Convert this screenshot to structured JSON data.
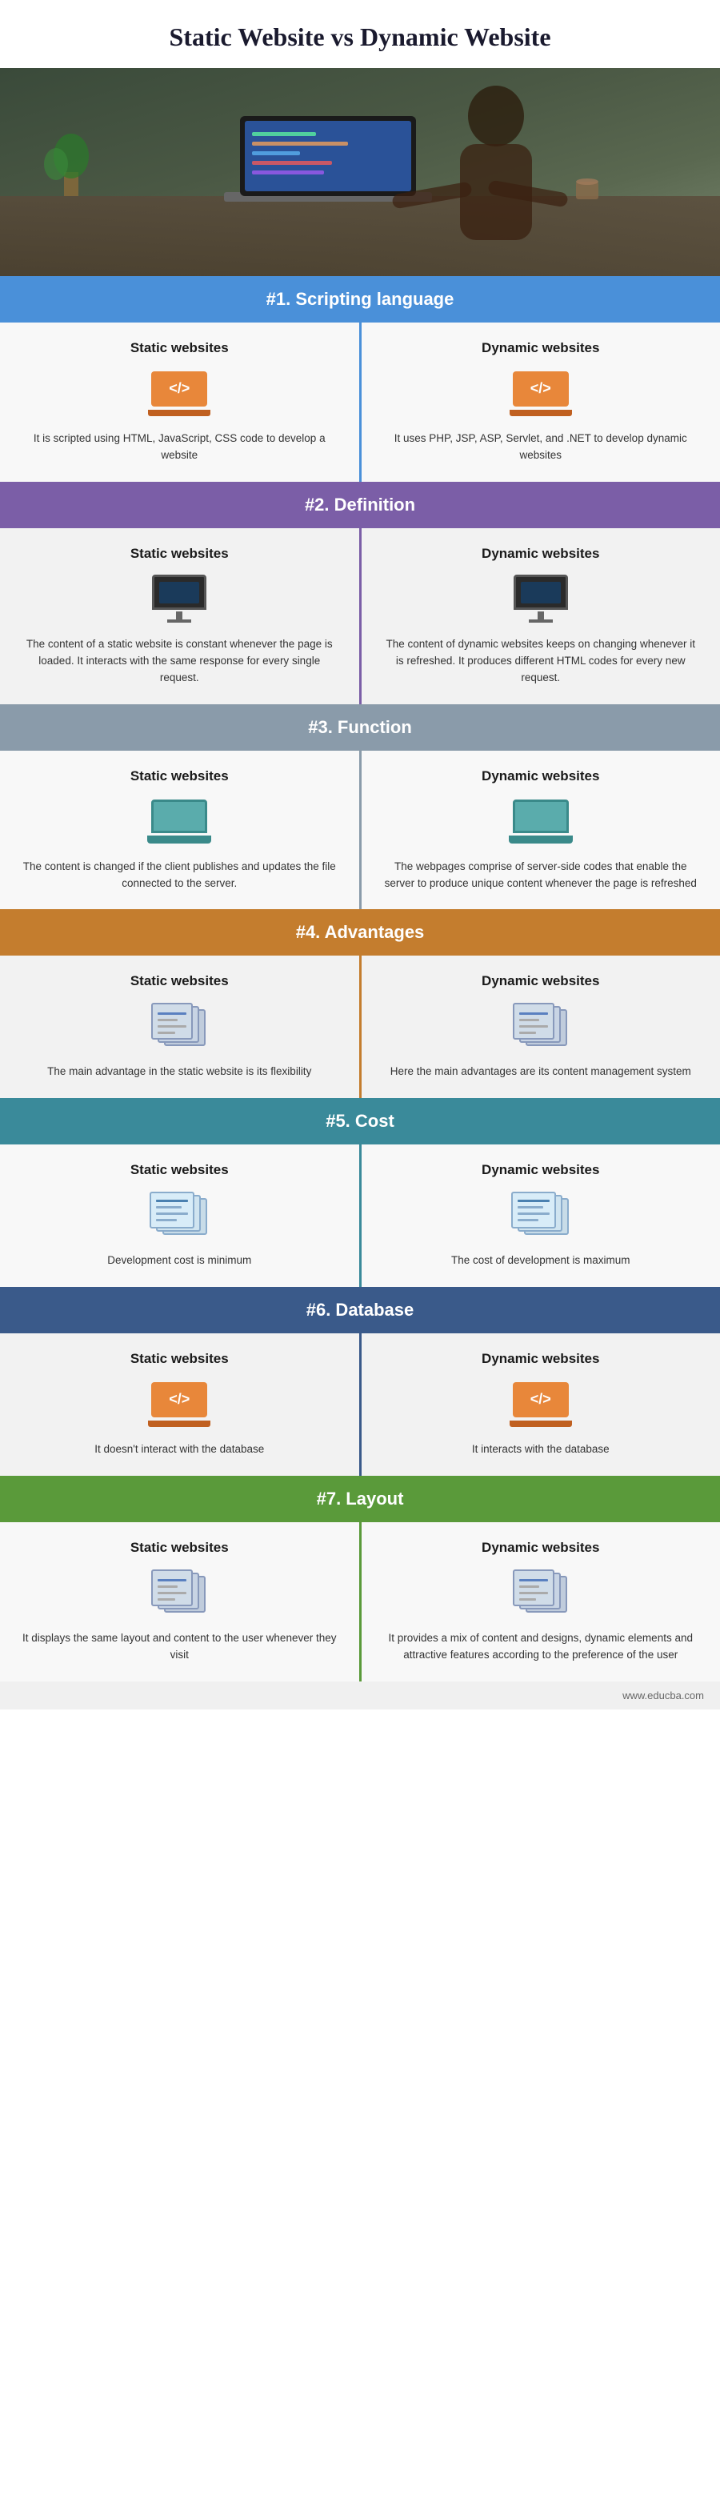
{
  "title": "Static Website vs Dynamic Website",
  "hero_alt": "Person working on laptop",
  "sections": [
    {
      "id": "scripting",
      "number": "#1.",
      "label": "Scripting language",
      "color_class": "blue",
      "divider_class": "divider-blue",
      "static_title": "Static websites",
      "dynamic_title": "Dynamic websites",
      "static_icon": "code-laptop-orange",
      "dynamic_icon": "code-laptop-orange",
      "static_text": "It is scripted using HTML, JavaScript, CSS code to develop a website",
      "dynamic_text": "It uses PHP, JSP, ASP, Servlet, and .NET to develop dynamic websites"
    },
    {
      "id": "definition",
      "number": "#2.",
      "label": "Definition",
      "color_class": "purple",
      "divider_class": "divider-purple",
      "static_title": "Static websites",
      "dynamic_title": "Dynamic websites",
      "static_icon": "monitor-dark",
      "dynamic_icon": "monitor-dark",
      "static_text": "The content of a static website is constant whenever the page is loaded. It interacts with the same response for every single request.",
      "dynamic_text": "The content of dynamic websites keeps on changing whenever it is refreshed. It produces different HTML codes for every new request."
    },
    {
      "id": "function",
      "number": "#3.",
      "label": "Function",
      "color_class": "gray",
      "divider_class": "divider-gray",
      "static_title": "Static websites",
      "dynamic_title": "Dynamic websites",
      "static_icon": "laptop-teal",
      "dynamic_icon": "laptop-teal",
      "static_text": "The content is changed if the client publishes and updates the file connected to the server.",
      "dynamic_text": "The webpages comprise of server-side codes that enable the server to produce unique content whenever the page is refreshed"
    },
    {
      "id": "advantages",
      "number": "#4.",
      "label": "Advantages",
      "color_class": "brown",
      "divider_class": "divider-brown",
      "static_title": "Static websites",
      "dynamic_title": "Dynamic websites",
      "static_icon": "files-stacked",
      "dynamic_icon": "files-stacked",
      "static_text": "The main advantage in the static website is its flexibility",
      "dynamic_text": "Here the main advantages are its content management system"
    },
    {
      "id": "cost",
      "number": "#5.",
      "label": "Cost",
      "color_class": "teal",
      "divider_class": "divider-teal",
      "static_title": "Static websites",
      "dynamic_title": "Dynamic websites",
      "static_icon": "document-lines",
      "dynamic_icon": "document-lines",
      "static_text": "Development cost is minimum",
      "dynamic_text": "The cost of development is maximum"
    },
    {
      "id": "database",
      "number": "#6.",
      "label": "Database",
      "color_class": "dark-blue",
      "divider_class": "divider-darkblue",
      "static_title": "Static websites",
      "dynamic_title": "Dynamic websites",
      "static_icon": "code-laptop-orange",
      "dynamic_icon": "code-laptop-orange",
      "static_text": "It doesn't interact with the database",
      "dynamic_text": "It interacts with the database"
    },
    {
      "id": "layout",
      "number": "#7.",
      "label": "Layout",
      "color_class": "green",
      "divider_class": "divider-green",
      "static_title": "Static websites",
      "dynamic_title": "Dynamic websites",
      "static_icon": "files-stacked",
      "dynamic_icon": "files-stacked",
      "static_text": "It displays the same layout and content to the user whenever they visit",
      "dynamic_text": "It provides a mix of content and designs, dynamic elements and attractive features according to the preference of the user"
    }
  ],
  "footer": "www.educba.com"
}
